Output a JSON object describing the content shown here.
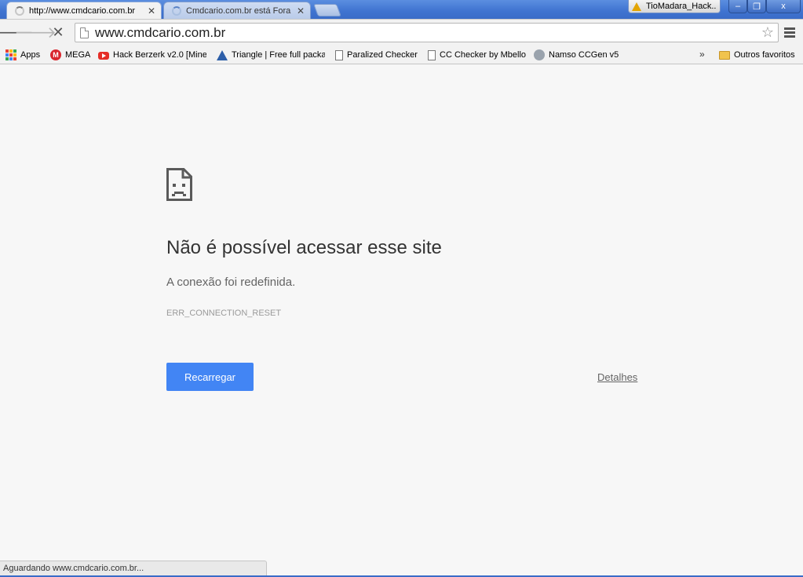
{
  "tabs": [
    {
      "title": "http://www.cmdcario.com.br",
      "active": true
    },
    {
      "title": "Cmdcario.com.br está Fora d",
      "active": false
    }
  ],
  "profile": {
    "name": "TioMadara_Hack..."
  },
  "window_controls": {
    "minimize": "–",
    "restore": "❐",
    "close": "x"
  },
  "toolbar": {
    "url": "www.cmdcario.com.br"
  },
  "bookmarks": [
    {
      "label": "Apps",
      "icon": "apps-grid-icon"
    },
    {
      "label": "MEGA",
      "icon": "mega-icon"
    },
    {
      "label": "Hack Berzerk v2.0 [Mine",
      "icon": "youtube-icon"
    },
    {
      "label": "Triangle | Free full packa",
      "icon": "triangle-icon"
    },
    {
      "label": "Paralized Checker",
      "icon": "page-icon"
    },
    {
      "label": "CC Checker by Mbello",
      "icon": "page-icon"
    },
    {
      "label": "Namso CCGen v5",
      "icon": "namso-icon"
    }
  ],
  "other_bookmarks": "Outros favoritos",
  "error": {
    "title": "Não é possível acessar esse site",
    "description": "A conexão foi redefinida.",
    "code": "ERR_CONNECTION_RESET",
    "reload_label": "Recarregar",
    "details_label": "Detalhes"
  },
  "status": "Aguardando www.cmdcario.com.br...",
  "colors": {
    "accent": "#4285f4",
    "titlebar": "#3f73d0",
    "background": "#f7f7f7"
  }
}
